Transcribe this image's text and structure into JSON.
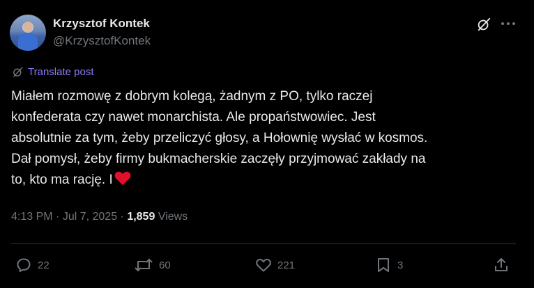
{
  "author": {
    "name": "Krzysztof Kontek",
    "handle": "@KrzysztofKontek"
  },
  "translate": {
    "label": "Translate post"
  },
  "tweet": {
    "lines": [
      "Miałem rozmowę z dobrym kolegą, żadnym z PO, tylko raczej",
      "konfederata czy nawet monarchista. Ale propaństwowiec. Jest",
      "absolutnie za tym, żeby przeliczyć głosy, a Hołownię wysłać w kosmos.",
      "Dał pomysł, żeby firmy bukmacherskie zaczęły przyjmować zakłady na",
      "to, kto ma rację. I"
    ],
    "emoji": "❤️"
  },
  "meta": {
    "time": "4:13 PM",
    "separator1": " · ",
    "date": "Jul 7, 2025",
    "separator2": " · ",
    "views_count": "1,859",
    "views_label": "Views"
  },
  "actions": {
    "replies": "22",
    "reposts": "60",
    "likes": "221",
    "bookmarks": "3"
  },
  "icons": {
    "avatar": "avatar",
    "grok": "grok-icon",
    "more": "more-icon",
    "translate": "translate-icon",
    "reply": "reply-icon",
    "repost": "repost-icon",
    "like": "heart-icon",
    "bookmark": "bookmark-icon",
    "share": "share-icon"
  },
  "colors": {
    "background": "#000000",
    "text": "#e7e9ea",
    "muted": "#71767b",
    "translate": "#8b7cf6",
    "divider": "#2f3336",
    "heart": "#f91880"
  }
}
